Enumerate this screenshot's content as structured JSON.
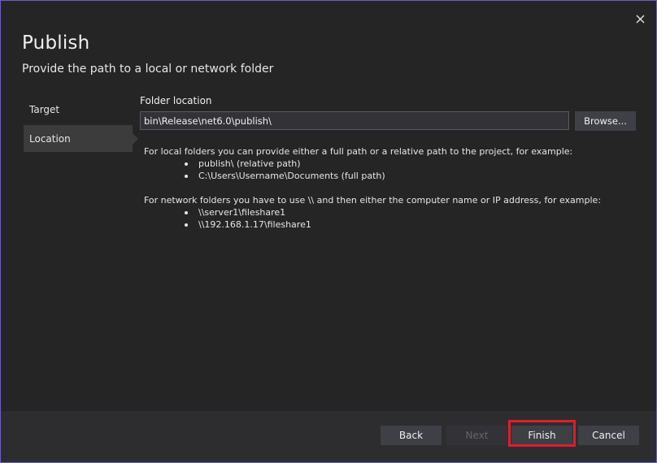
{
  "dialog": {
    "title": "Publish",
    "subtitle": "Provide the path to a local or network folder",
    "close_icon": "close-icon"
  },
  "nav": {
    "items": [
      {
        "label": "Target",
        "active": false
      },
      {
        "label": "Location",
        "active": true
      }
    ]
  },
  "location": {
    "field_label": "Folder location",
    "path_value": "bin\\Release\\net6.0\\publish\\",
    "browse_label": "Browse..."
  },
  "help": {
    "local_intro": "For local folders you can provide either a full path or a relative path to the project, for example:",
    "local_examples": [
      "publish\\ (relative path)",
      "C:\\Users\\Username\\Documents (full path)"
    ],
    "network_intro": "For network folders you have to use \\\\ and then either the computer name or IP address, for example:",
    "network_examples": [
      "\\\\server1\\fileshare1",
      "\\\\192.168.1.17\\fileshare1"
    ]
  },
  "footer": {
    "back_label": "Back",
    "next_label": "Next",
    "finish_label": "Finish",
    "cancel_label": "Cancel"
  },
  "colors": {
    "background": "#252526",
    "border_accent": "#6c5fc7",
    "highlight": "#e01e2b"
  }
}
